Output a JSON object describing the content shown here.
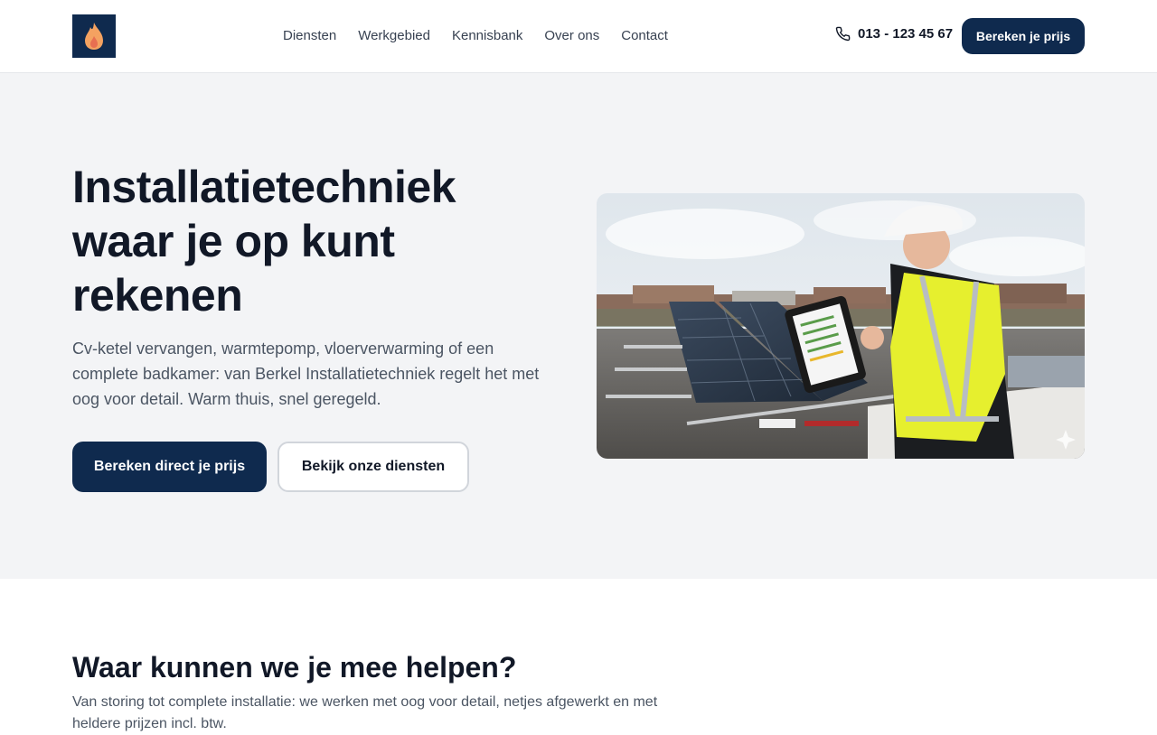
{
  "header": {
    "logo_icon": "flame-icon",
    "nav": [
      "Diensten",
      "Werkgebied",
      "Kennisbank",
      "Over ons",
      "Contact"
    ],
    "phone_icon": "phone-icon",
    "phone": "013 - 123 45 67",
    "cta": "Bereken je prijs"
  },
  "hero": {
    "title": "Installatietechniek waar je op kunt rekenen",
    "intro": "Cv-ketel vervangen, warmtepomp, vloerverwarming of een complete badkamer: van Berkel Installatietechniek regelt het met oog voor detail. Warm thuis, snel geregeld.",
    "primary_cta": "Bereken direct je prijs",
    "secondary_cta": "Bekijk onze diensten",
    "image_icon": "sparkle-icon"
  },
  "services": {
    "title": "Waar kunnen we je mee helpen?",
    "intro": "Van storing tot complete installatie: we werken met oog voor detail, netjes afgewerkt en met heldere prijzen incl. btw."
  },
  "colors": {
    "brand": "#0f2a4e",
    "flame": "#f4a261",
    "hero_bg": "#f3f4f6"
  }
}
